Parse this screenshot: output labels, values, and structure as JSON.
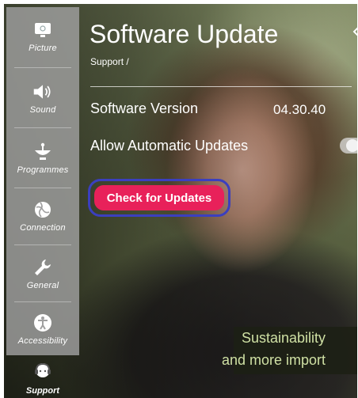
{
  "sidebar": {
    "items": [
      {
        "label": "Picture",
        "icon": "picture-icon"
      },
      {
        "label": "Sound",
        "icon": "speaker-icon"
      },
      {
        "label": "Programmes",
        "icon": "satellite-dish-icon"
      },
      {
        "label": "Connection",
        "icon": "globe-icon"
      },
      {
        "label": "General",
        "icon": "wrench-icon"
      },
      {
        "label": "Accessibility",
        "icon": "accessibility-icon"
      }
    ],
    "support": {
      "label": "Support",
      "icon": "support-icon"
    }
  },
  "header": {
    "title": "Software Update",
    "breadcrumb": "Support /"
  },
  "settings": {
    "software_version_label": "Software Version",
    "software_version_value": "04.30.40",
    "auto_updates_label": "Allow Automatic Updates",
    "auto_updates_enabled": true,
    "check_button_label": "Check for Updates"
  },
  "video": {
    "caption_line1": "Sustainability",
    "caption_line2": "and more import"
  },
  "colors": {
    "accent": "#e8215a",
    "focus_ring": "#3b3fbf",
    "sidebar_bg": "#a0a0a0"
  }
}
